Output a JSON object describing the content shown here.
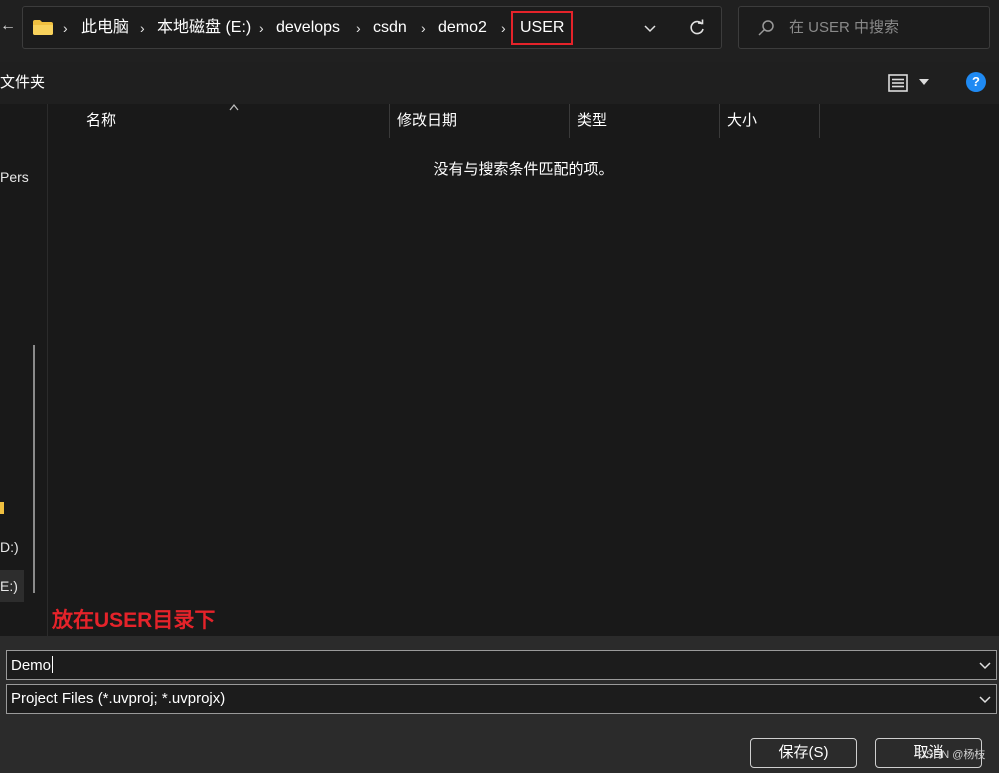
{
  "address_bar": {
    "back_glyph": "←",
    "folder_icon": "folder-icon",
    "breadcrumbs": [
      "此电脑",
      "本地磁盘 (E:)",
      "develops",
      "csdn",
      "demo2",
      "USER"
    ],
    "separator": "›",
    "highlight_color": "#e5232a"
  },
  "search": {
    "placeholder": "在 USER 中搜索"
  },
  "command_bar": {
    "new_folder_label": "文件夹",
    "help_glyph": "?"
  },
  "nav": {
    "fragments": [
      "Pers",
      "D:)",
      "E:)"
    ]
  },
  "file_list": {
    "columns": [
      "名称",
      "修改日期",
      "类型",
      "大小"
    ],
    "empty_message": "没有与搜索条件匹配的项。"
  },
  "annotation": {
    "text": "放在USER目录下",
    "color": "#e5232a"
  },
  "bottom": {
    "filename_value": "Demo",
    "filetype_value": "Project Files (*.uvproj; *.uvprojx)",
    "save_label": "保存(S)",
    "cancel_label": "取消",
    "watermark": "CSDN @杨枝"
  },
  "colors": {
    "background": "#191919",
    "help_blue": "#1f8af3"
  }
}
